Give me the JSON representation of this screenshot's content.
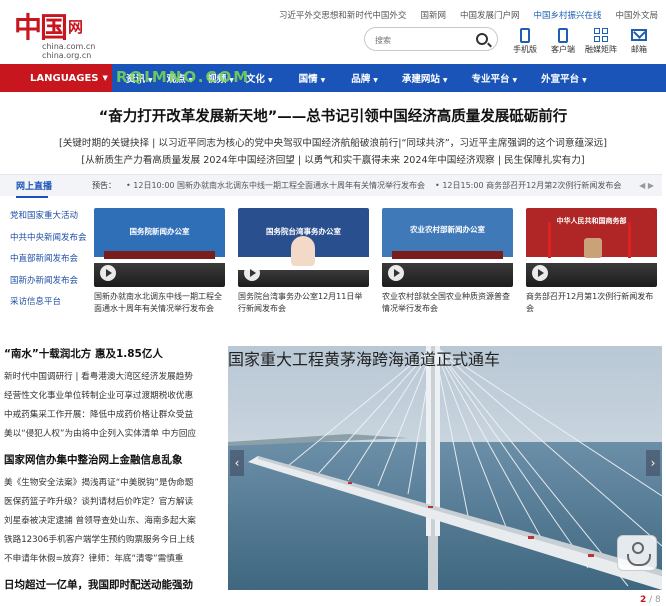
{
  "logo": {
    "mark": "中国",
    "wang": "网",
    "domain1": "china.com.cn",
    "domain2": "china.org.cn"
  },
  "top_links": [
    {
      "label": "习近平外交思想和新时代中国外交",
      "highlight": false
    },
    {
      "label": "国新网",
      "highlight": false
    },
    {
      "label": "中国发展门户网",
      "highlight": false
    },
    {
      "label": "中国乡村振兴在线",
      "highlight": true
    },
    {
      "label": "中国外文局",
      "highlight": false
    }
  ],
  "search": {
    "placeholder": "搜索"
  },
  "quick_icons": [
    {
      "label": "手机版",
      "icon": "phone-icon"
    },
    {
      "label": "客户端",
      "icon": "phone-icon"
    },
    {
      "label": "融媒矩阵",
      "icon": "grid-icon"
    },
    {
      "label": "邮箱",
      "icon": "mail-icon"
    }
  ],
  "nav": {
    "lang_label": "LANGUAGES",
    "items": [
      "资讯",
      "观点",
      "视频",
      "文化",
      "国情",
      "品牌",
      "承建网站",
      "专业平台",
      "外宣平台"
    ]
  },
  "watermark": "RQIMNO.COM",
  "headline": "“奋力打开改革发展新天地”——总书记引领中国经济高质量发展砥砺前行",
  "sublines": [
    "[关键时期的关键抉择 | 以习近平同志为核心的党中央驾驭中国经济航船破浪前行|“同球共济”，习近平主席强调的这个词意蕴深远]",
    "[从新质生产力看高质量发展 2024年中国经济回望 | 以勇气和实干赢得未来 2024年中国经济观察 | 民生保障扎实有力]"
  ],
  "live": {
    "title": "网上直播",
    "preview_label": "预告：",
    "tickers": [
      "12日10:00 国新办就南水北调东中线一期工程全面通水十周年有关情况举行发布会",
      "12日15:00 商务部召开12月第2次例行新闻发布会"
    ],
    "arrows": "◀ ▶"
  },
  "side_menu": [
    "党和国家重大活动",
    "中共中央新闻发布会",
    "中直部新闻发布会",
    "国新办新闻发布会",
    "采访信息平台"
  ],
  "release_cards": [
    {
      "sign": "国务院新闻办公室",
      "caption": "国新办就南水北调东中线一期工程全面通水十周年有关情况举行发布会",
      "backdrop": "#2f6fb8",
      "play": true
    },
    {
      "sign": "国务院台湾事务办公室",
      "caption": "国务院台湾事务办公室12月11日举行新闻发布会",
      "backdrop": "#2a4f8f",
      "play": true
    },
    {
      "sign": "农业农村部新闻办公室",
      "caption": "农业农村部就全国农业种质资源普查情况举行发布会",
      "backdrop": "#3f79b8",
      "play": true
    },
    {
      "sign": "中华人民共和国商务部",
      "caption": "商务部召开12月第1次例行新闻发布会",
      "backdrop": "#b02525",
      "play": true
    }
  ],
  "news": [
    {
      "title": "“南水”十载润北方 惠及1.85亿人",
      "lines": [
        "新时代中国调研行 | 看粤港澳大湾区经济发展趋势",
        "经营性文化事业单位转制企业可享过渡期税收优惠",
        "中戒药集采工作开展：降低中成药价格让群众受益",
        "美以“侵犯人权”为由将中企列入实体清单 中方回应"
      ]
    },
    {
      "title": "国家网信办集中整治网上金融信息乱象",
      "lines": [
        "美《生物安全法案》揭浅再证“中美脱钩”是伪命题",
        "医保药篮子咋升级？谈判请材后价咋定？官方解读",
        "刘星泰被决定逮捕 曾领导查处山东、海南多起大案",
        "铁路12306手机客户端学生预约购票服务今日上线",
        "不申请年休假=放弃？律师：年底“清零”需慎重"
      ]
    },
    {
      "title": "日均超过一亿单，我国即时配送动能强劲",
      "lines": []
    }
  ],
  "slideshow": {
    "caption": "国家重大工程黄茅海跨海通道正式通车",
    "current": "2",
    "separator": " / ",
    "total": "8",
    "prev_arrow": "‹",
    "next_arrow": "›"
  }
}
